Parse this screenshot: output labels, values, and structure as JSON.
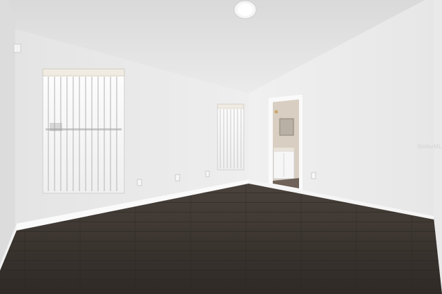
{
  "photo": {
    "subject": "empty-room",
    "watermark": "StellarMLS",
    "colors": {
      "ceiling": "#e3e3e3",
      "wall": "#ececec",
      "floor": "#3c3631",
      "baseboard": "#fafafa",
      "blind": "#f4f4f4"
    }
  }
}
